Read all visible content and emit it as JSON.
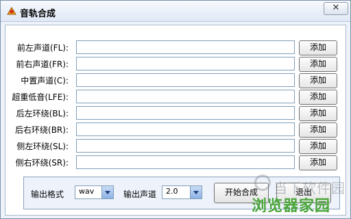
{
  "window": {
    "title": "音轨合成",
    "close_label": "✕"
  },
  "rows": [
    {
      "label": "前左声道(FL):",
      "value": "",
      "button": "添加"
    },
    {
      "label": "前右声道(FR):",
      "value": "",
      "button": "添加"
    },
    {
      "label": "中置声道(C):",
      "value": "",
      "button": "添加"
    },
    {
      "label": "超重低音(LFE):",
      "value": "",
      "button": "添加"
    },
    {
      "label": "后左环绕(BL):",
      "value": "",
      "button": "添加"
    },
    {
      "label": "后右环绕(BR):",
      "value": "",
      "button": "添加"
    },
    {
      "label": "侧左环绕(SL):",
      "value": "",
      "button": "添加"
    },
    {
      "label": "侧右环绕(SR):",
      "value": "",
      "button": "添加"
    }
  ],
  "bottom": {
    "format_label": "输出格式",
    "format_value": "wav",
    "channel_label": "输出声道",
    "channel_value": "2.0",
    "start_button": "开始合成",
    "exit_button": "退出"
  },
  "watermark": {
    "line1": "当下软件园",
    "line2": "浏览器家园"
  },
  "colors": {
    "title_bg": "#e9eff8",
    "accent": "#4aa63a"
  },
  "icons": {
    "app": "app-icon",
    "close": "close-icon",
    "dropdown": "chevron-down-icon"
  }
}
